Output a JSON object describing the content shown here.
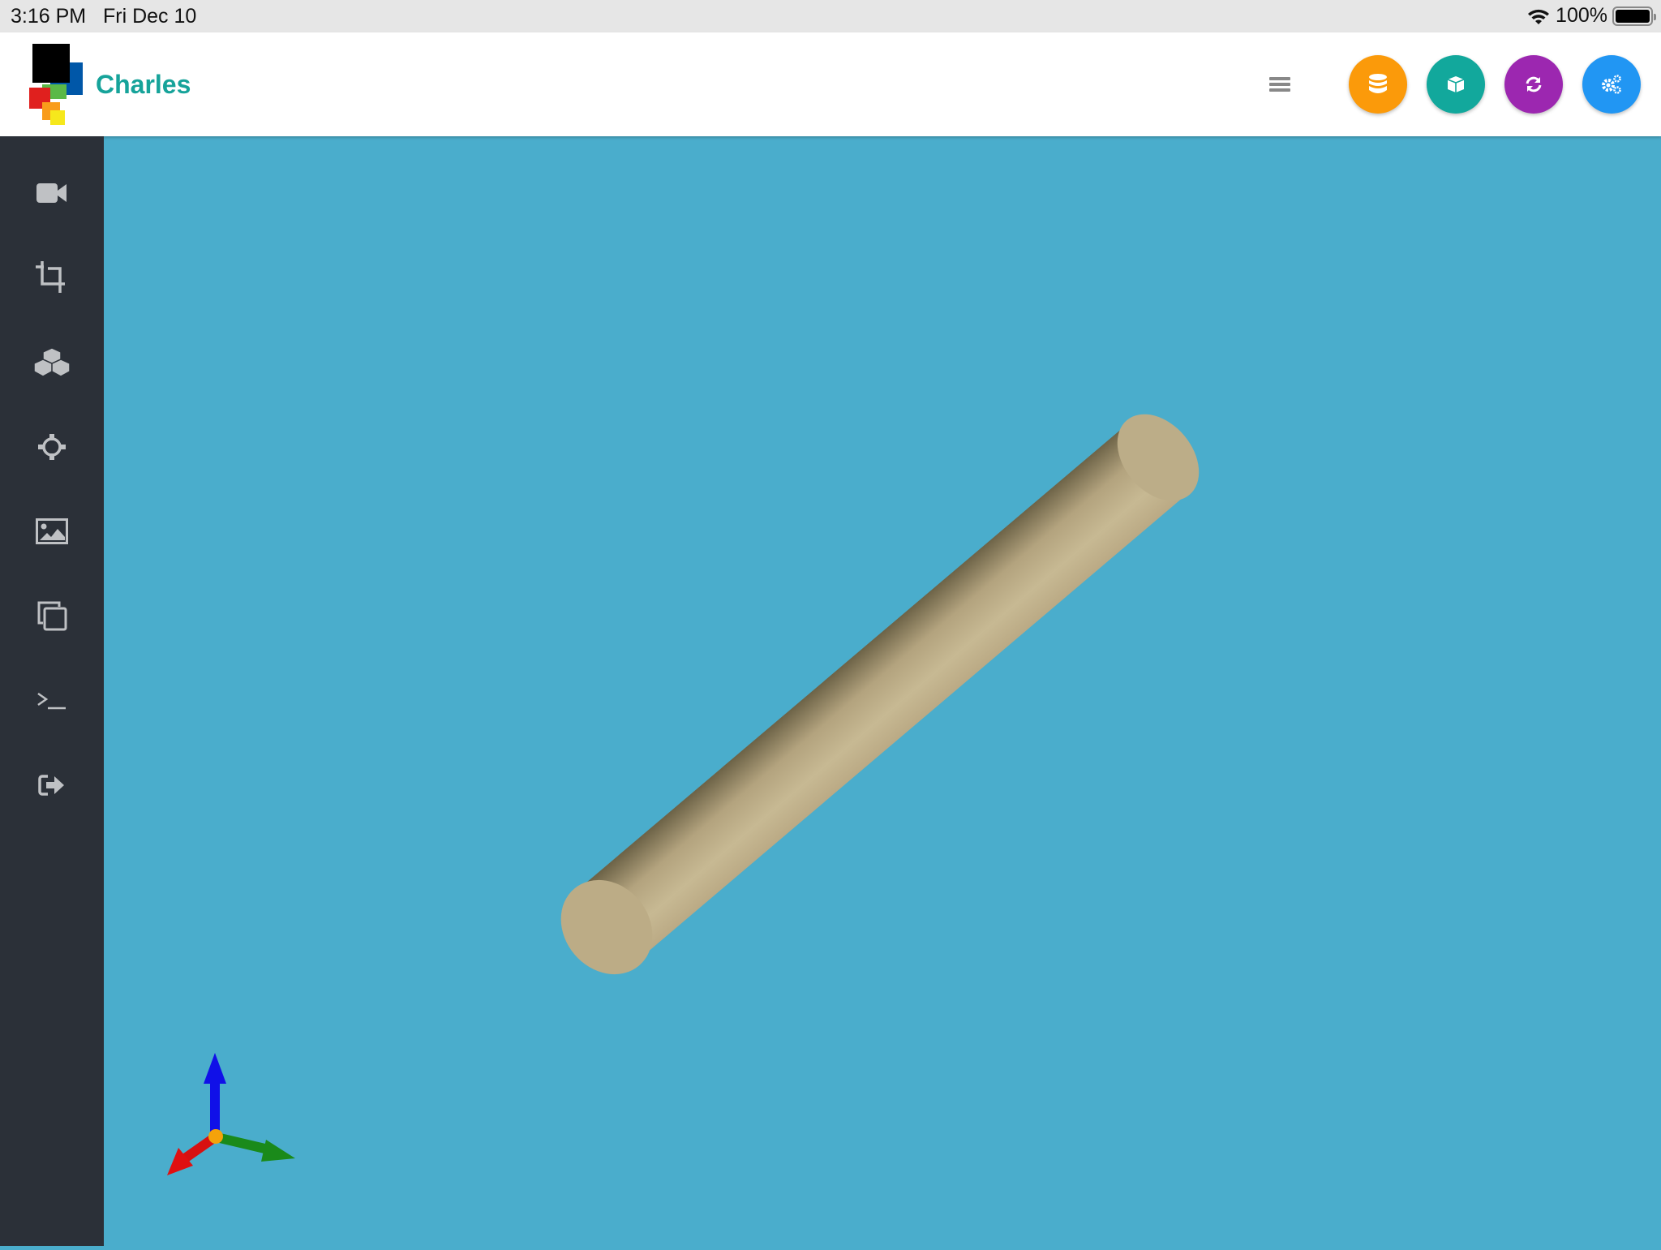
{
  "status_bar": {
    "time": "3:16 PM",
    "date": "Fri Dec 10",
    "battery": "100%",
    "battery_level": 1.0
  },
  "header": {
    "app_name": "Charles",
    "menu_icon": "hamburger-icon",
    "actions": [
      {
        "name": "database-button",
        "icon": "database-icon",
        "color": "#fb9a0a"
      },
      {
        "name": "cube-button",
        "icon": "cube-icon",
        "color": "#12a89c"
      },
      {
        "name": "refresh-button",
        "icon": "refresh-icon",
        "color": "#9c27b0"
      },
      {
        "name": "settings-button",
        "icon": "gears-icon",
        "color": "#2196f3"
      }
    ]
  },
  "sidebar": {
    "items": [
      {
        "icon": "video-camera-icon"
      },
      {
        "icon": "crop-icon"
      },
      {
        "icon": "cubes-icon"
      },
      {
        "icon": "crosshairs-icon"
      },
      {
        "icon": "image-icon"
      },
      {
        "icon": "copy-icon"
      },
      {
        "icon": "terminal-icon"
      },
      {
        "icon": "sign-out-icon"
      }
    ]
  },
  "viewport": {
    "background": "#4aadcc",
    "object_color": "#bcac86",
    "axes": {
      "x": "#e01010",
      "y": "#1a8a1a",
      "z": "#1010e8"
    }
  }
}
